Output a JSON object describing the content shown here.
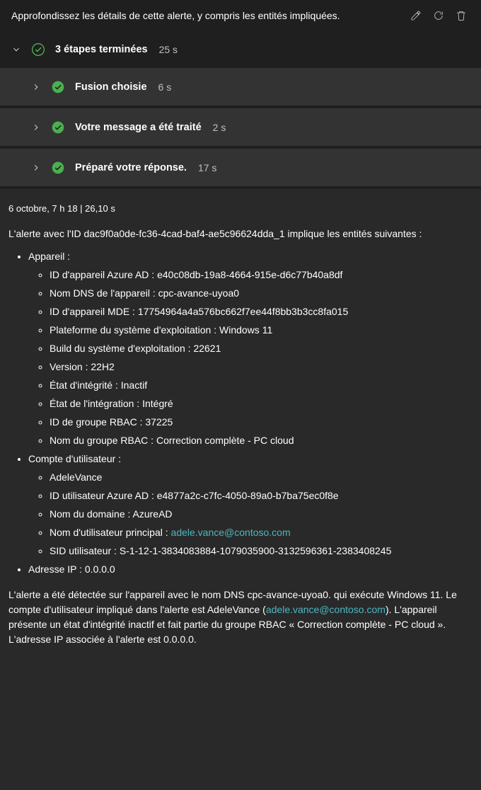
{
  "header": {
    "title": "Approfondissez les détails de cette alerte, y compris les entités impliquées."
  },
  "steps": {
    "summary_label": "3 étapes terminées",
    "summary_time": "25 s",
    "items": [
      {
        "label": "Fusion choisie",
        "time": "6 s"
      },
      {
        "label": "Votre message a été traité",
        "time": "2 s"
      },
      {
        "label": "Préparé votre réponse.",
        "time": "17 s"
      }
    ]
  },
  "timestamp": "6 octobre, 7 h 18 | 26,10 s",
  "intro": "L'alerte avec l'ID dac9f0a0de-fc36-4cad-baf4-ae5c96624dda_1 implique les entités suivantes :",
  "device": {
    "heading": "Appareil :",
    "azure_ad_id": "ID d'appareil Azure AD : e40c08db-19a8-4664-915e-d6c77b40a8df",
    "dns": "Nom DNS de l'appareil : cpc-avance-uyoa0",
    "mde_id": "ID d'appareil MDE : 17754964a4a576bc662f7ee44f8bb3b3cc8fa015",
    "os_platform": "Plateforme du système d'exploitation : Windows 11",
    "os_build": "Build du système d'exploitation : 22621",
    "version": "Version : 22H2",
    "health": "État d'intégrité : Inactif",
    "onboarding": "État de l'intégration : Intégré",
    "rbac_id": "ID de groupe RBAC : 37225",
    "rbac_name": "Nom du groupe RBAC : Correction complète - PC cloud"
  },
  "user": {
    "heading": "Compte d'utilisateur :",
    "name": "AdeleVance",
    "azure_ad_id": "ID utilisateur Azure AD : e4877a2c-c7fc-4050-89a0-b7ba75ec0f8e",
    "domain": "Nom du domaine : AzureAD",
    "upn_label": "Nom d'utilisateur principal : ",
    "upn_link": "adele.vance@contoso.com",
    "sid": "SID utilisateur : S-1-12-1-3834083884-1079035900-3132596361-2383408245"
  },
  "ip": "Adresse IP : 0.0.0.0",
  "footer": {
    "part1": "L'alerte a été détectée sur l'appareil avec le nom DNS cpc-avance-uyoa0. qui exécute Windows 11. Le compte d'utilisateur impliqué dans l'alerte est AdeleVance (",
    "link": "adele.vance@contoso.com",
    "part2": "). L'appareil présente un état d'intégrité inactif et fait partie du groupe RBAC « Correction complète - PC cloud ». L'adresse IP associée à l'alerte est 0.0.0.0."
  }
}
